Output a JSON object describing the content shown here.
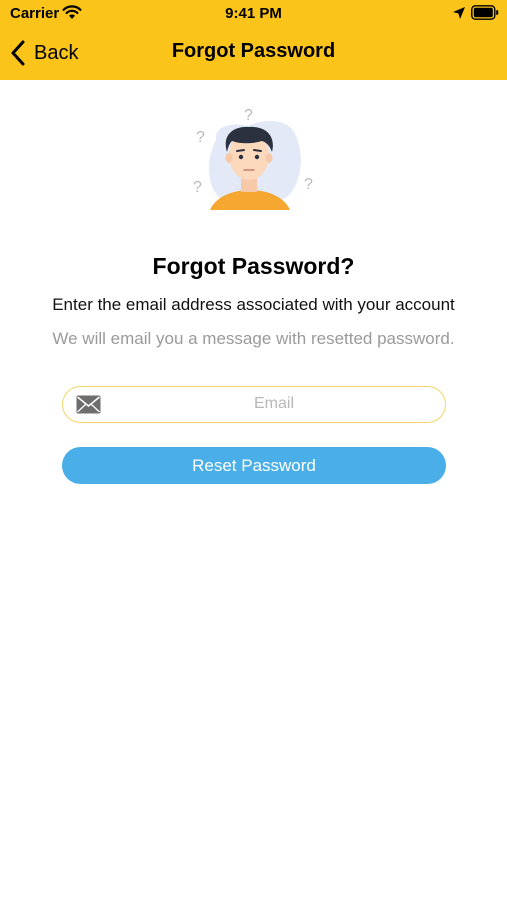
{
  "status_bar": {
    "carrier": "Carrier",
    "time": "9:41 PM"
  },
  "nav": {
    "back_label": "Back",
    "title": "Forgot Password"
  },
  "content": {
    "heading": "Forgot Password?",
    "subtitle": "Enter the email address associated with your account",
    "helper": "We will email you a message with resetted password."
  },
  "form": {
    "email_placeholder": "Email",
    "email_value": "",
    "reset_label": "Reset Password"
  },
  "icons": {
    "back": "chevron-left-icon",
    "email": "envelope-icon",
    "wifi": "wifi-icon",
    "location": "location-arrow-icon",
    "battery": "battery-icon"
  },
  "colors": {
    "brand_yellow": "#FBC41B",
    "button_blue": "#4AAEE8",
    "input_border": "#F5D66A",
    "helper_text": "#9a9a9a"
  }
}
